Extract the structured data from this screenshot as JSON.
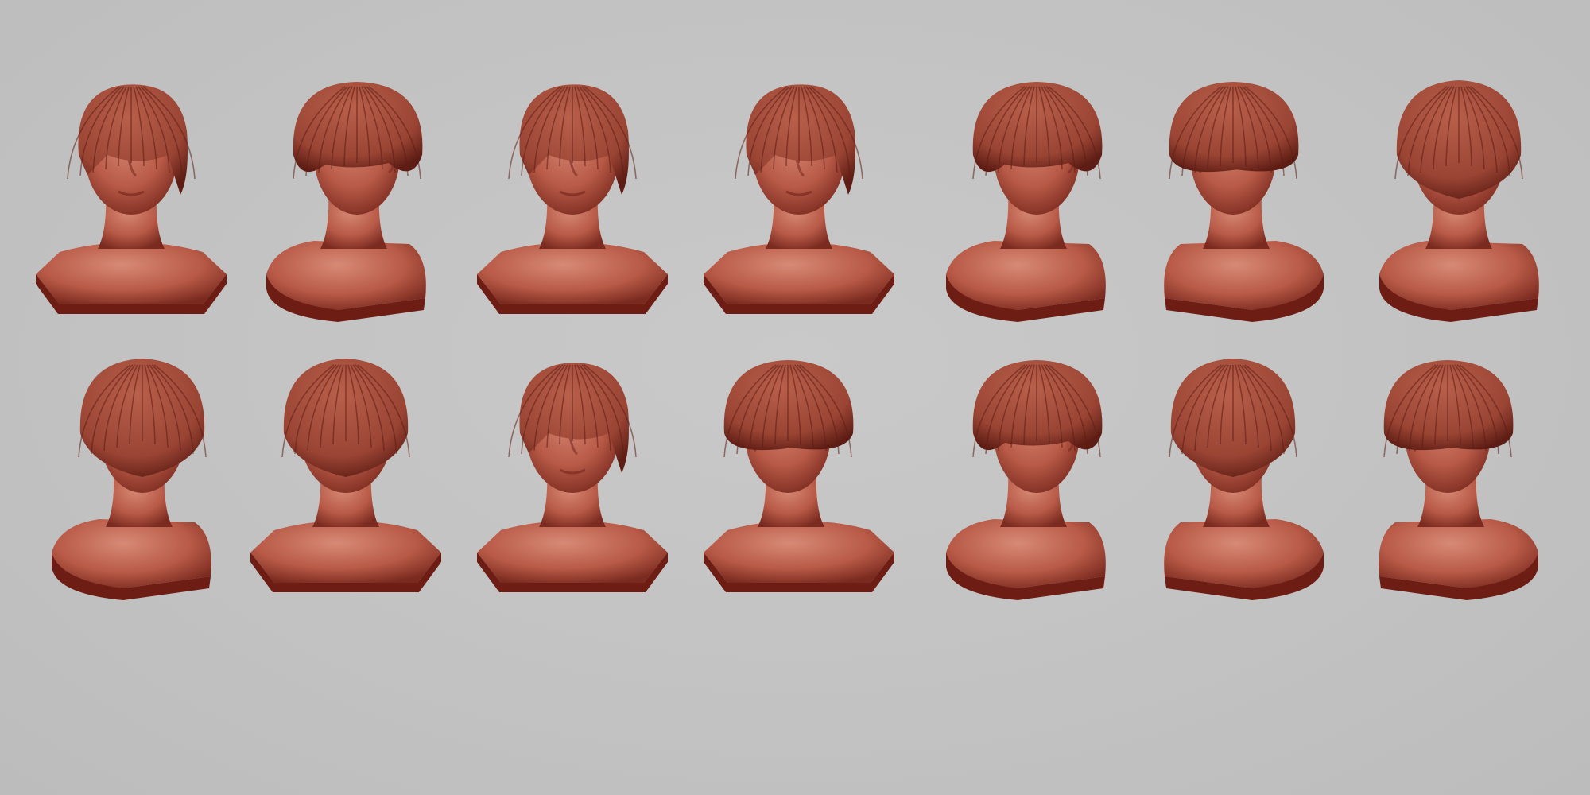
{
  "palette": {
    "background": "#c4c4c4",
    "clay_light": "#d78a76",
    "clay_mid": "#b85a47",
    "clay_dark": "#7a2a1f",
    "hair": "#9a4434",
    "hair_dark": "#5e1d14",
    "base_dark": "#6e1d14"
  },
  "rows": [
    {
      "views": [
        {
          "view": "front-three-quarter-up",
          "facing": 0,
          "hair": "fringe",
          "base": "front"
        },
        {
          "view": "top-back-right",
          "facing": 1,
          "hair": "bowl",
          "base": "side"
        },
        {
          "view": "front",
          "facing": 0,
          "hair": "fringe",
          "base": "front"
        },
        {
          "view": "front",
          "facing": 0,
          "hair": "fringe",
          "base": "front"
        },
        {
          "view": "profile-right",
          "facing": 1,
          "hair": "bowl",
          "base": "side"
        },
        {
          "view": "three-quarter-left",
          "facing": -1,
          "hair": "bowl",
          "base": "side"
        },
        {
          "view": "back-three-quarter",
          "facing": 0,
          "hair": "back",
          "base": "side"
        }
      ]
    },
    {
      "views": [
        {
          "view": "back-three-quarter-right",
          "facing": 1,
          "hair": "back",
          "base": "side"
        },
        {
          "view": "back",
          "facing": 0,
          "hair": "back",
          "base": "back"
        },
        {
          "view": "front-down",
          "facing": 0,
          "hair": "fringe",
          "base": "front"
        },
        {
          "view": "top-front-down",
          "facing": -1,
          "hair": "bowl",
          "base": "front"
        },
        {
          "view": "profile-right",
          "facing": 1,
          "hair": "bowl",
          "base": "side"
        },
        {
          "view": "back-three-quarter-left",
          "facing": -1,
          "hair": "back",
          "base": "side"
        },
        {
          "view": "profile-left",
          "facing": -1,
          "hair": "bowl",
          "base": "side"
        }
      ]
    }
  ]
}
